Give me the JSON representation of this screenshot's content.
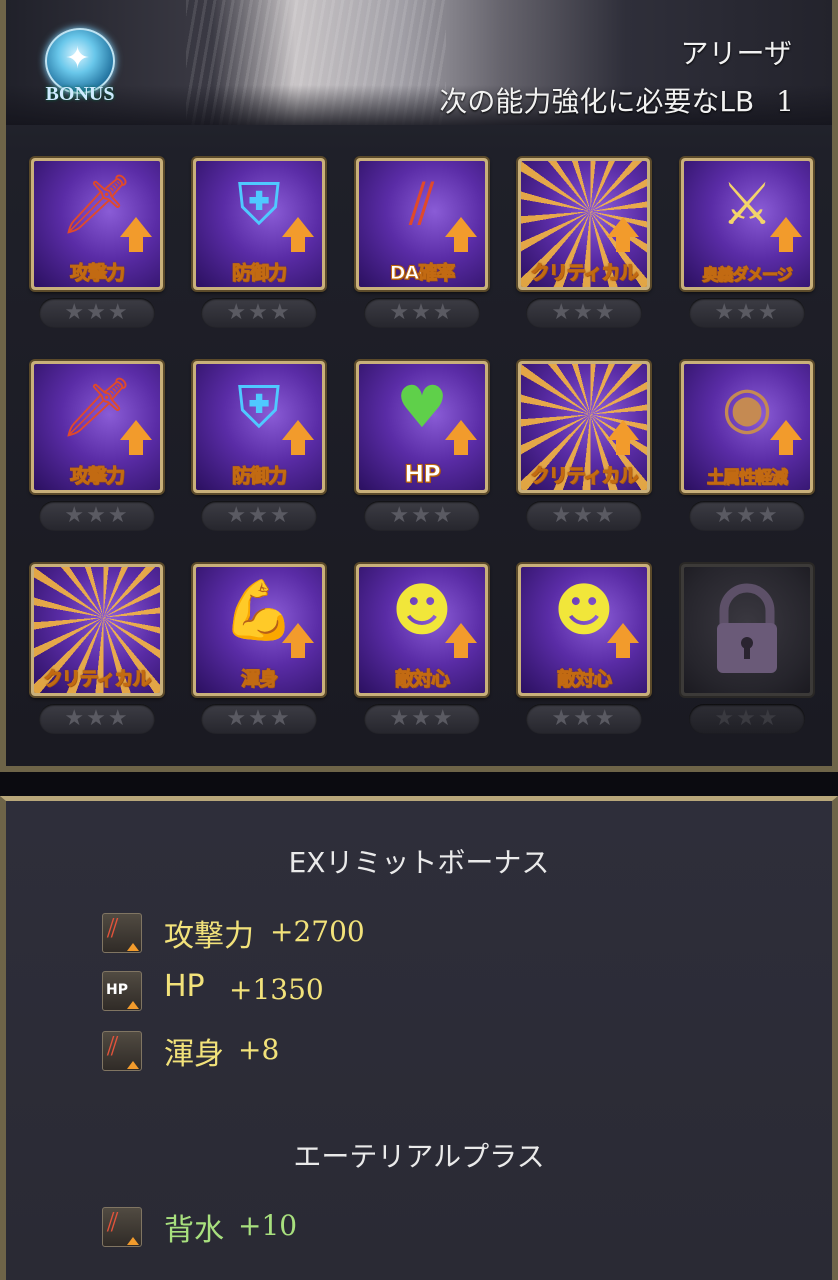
{
  "header": {
    "bonus_badge_text": "BONUS",
    "character_name": "アリーザ",
    "lb_requirement_label": "次の能力強化に必要なLB",
    "lb_requirement_value": "1"
  },
  "skills": [
    {
      "label": "攻撃力",
      "icon": "red-sword-icon",
      "stars": "★★★"
    },
    {
      "label": "防御力",
      "icon": "shield-icon",
      "stars": "★★★"
    },
    {
      "label": "DA確率",
      "icon": "double-attack-icon",
      "stars": "★★★"
    },
    {
      "label": "クリティカル",
      "icon": "critical-burst-icon",
      "stars": "★★★"
    },
    {
      "label": "奥義ダメージ",
      "icon": "crossed-swords-icon",
      "stars": "★★★"
    },
    {
      "label": "攻撃力",
      "icon": "red-sword-icon",
      "stars": "★★★"
    },
    {
      "label": "防御力",
      "icon": "shield-icon",
      "stars": "★★★"
    },
    {
      "label": "HP",
      "icon": "green-heart-icon",
      "stars": "★★★"
    },
    {
      "label": "クリティカル",
      "icon": "critical-burst-icon",
      "stars": "★★★"
    },
    {
      "label": "土属性軽減",
      "icon": "earth-resist-icon",
      "stars": "★★★"
    },
    {
      "label": "クリティカル",
      "icon": "critical-burst-icon",
      "stars": "★★★"
    },
    {
      "label": "渾身",
      "icon": "flexed-arm-icon",
      "stars": "★★★"
    },
    {
      "label": "敵対心",
      "icon": "demon-face-icon",
      "stars": "★★★"
    },
    {
      "label": "敵対心",
      "icon": "demon-face-icon",
      "stars": "★★★"
    },
    {
      "label": "",
      "icon": "lock-icon",
      "stars": "★★★",
      "locked": true
    }
  ],
  "ex_limit": {
    "title": "EXリミットボーナス",
    "items": [
      {
        "label": "攻撃力",
        "value": "+2700",
        "icon": "attack-up-icon"
      },
      {
        "label": "HP",
        "value": "+1350",
        "icon": "hp-up-icon"
      },
      {
        "label": "渾身",
        "value": "+8",
        "icon": "attack-up-icon"
      }
    ]
  },
  "ethereal_plus": {
    "title": "エーテリアルプラス",
    "items": [
      {
        "label": "背水",
        "value": "+10",
        "icon": "attack-up-icon"
      }
    ]
  },
  "colors": {
    "gold_text": "#f2e27a",
    "green_text": "#a8e07e",
    "frame_gold": "#c9b07a",
    "arrow_orange": "#f29b2c"
  }
}
